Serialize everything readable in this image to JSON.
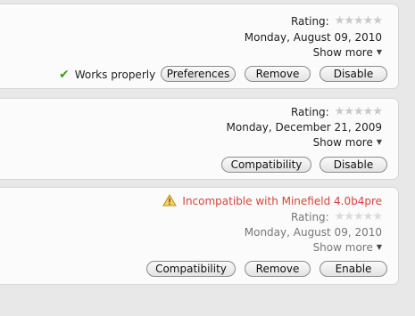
{
  "addons": [
    {
      "rating_label": "Rating:",
      "stars": "★★★★★",
      "date": "Monday, August 09, 2010",
      "show_more": "Show more",
      "status": "Works properly",
      "buttons": {
        "preferences": "Preferences",
        "remove": "Remove",
        "disable": "Disable"
      }
    },
    {
      "rating_label": "Rating:",
      "stars": "★★★★★",
      "date": "Monday, December 21, 2009",
      "show_more": "Show more",
      "buttons": {
        "compatibility": "Compatibility",
        "disable": "Disable"
      }
    },
    {
      "warning": "Incompatible with Minefield 4.0b4pre",
      "rating_label": "Rating:",
      "stars": "★★★★★",
      "date": "Monday, August 09, 2010",
      "show_more": "Show more",
      "buttons": {
        "compatibility": "Compatibility",
        "remove": "Remove",
        "enable": "Enable"
      }
    }
  ],
  "colors": {
    "ok_green": "#3da11f",
    "warning_red": "#d8433b",
    "empty_star": "#c9c9c9"
  }
}
